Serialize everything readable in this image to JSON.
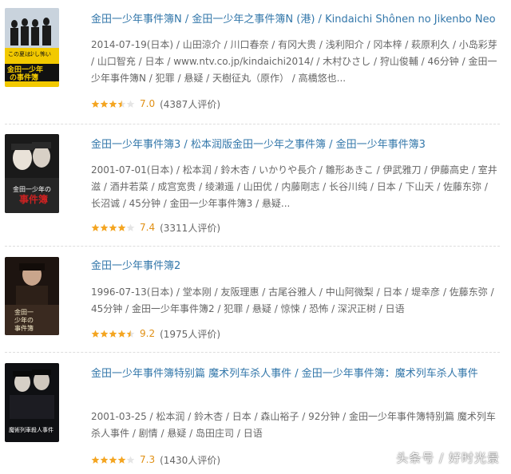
{
  "colors": {
    "link": "#3377aa",
    "meta_text": "#666666",
    "score": "#e09015",
    "star_full": "#f4a521",
    "star_empty": "#e5e5e5",
    "divider": "#dddddd"
  },
  "items": [
    {
      "title_parts": [
        "金田一少年事件簿N",
        "金田一少年之事件簿N (港)",
        "Kindaichi Shônen no Jikenbo Neo"
      ],
      "meta": "2014-07-19(日本) / 山田涼介 / 川口春奈 / 有冈大贵 / 浅利阳介 / 冈本梓 / 萩原利久 / 小岛彩芽 / 山口智充 / 日本 / www.ntv.co.jp/kindaichi2014/ / 木村ひさし / 狩山俊輔 / 46分钟 / 金田一少年事件簿N / 犯罪 / 悬疑 / 天樹征丸（原作） / 高橋悠也...",
      "stars": 3.5,
      "score": "7.0",
      "count": "(4387人评价)",
      "poster_text": [
        "この夏は、",
        "少し怖い",
        "金田一少年",
        "の事件簿"
      ]
    },
    {
      "title_parts": [
        "金田一少年事件簿3",
        "松本润版金田一少年之事件簿",
        "金田一少年事件簿3"
      ],
      "meta": "2001-07-01(日本) / 松本润 / 鈴木杏 / いかりや長介 / 雛形あきこ / 伊武雅刀 / 伊藤高史 / 室井滋 / 酒井若菜 / 成宫宽贵 / 绫濑遥 / 山田优 / 内藤剛志 / 长谷川纯 / 日本 / 下山天 / 佐藤东弥 / 长沼诚 / 45分钟 / 金田一少年事件簿3 / 悬疑...",
      "stars": 4,
      "score": "7.4",
      "count": "(3311人评价)",
      "poster_text": [
        "金田一少年の",
        "事件簿"
      ]
    },
    {
      "title_parts": [
        "金田一少年事件簿2"
      ],
      "meta": "1996-07-13(日本) / 堂本刚 / 友阪理惠 / 古尾谷雅人 / 中山阿微梨 / 日本 / 堤幸彦 / 佐藤东弥 / 45分钟 / 金田一少年事件簿2 / 犯罪 / 悬疑 / 惊悚 / 恐怖 / 深沢正树 / 日语",
      "stars": 4.5,
      "score": "9.2",
      "count": "(1975人评价)",
      "poster_text": [
        "金田一",
        "少年の",
        "事件簿"
      ]
    },
    {
      "title_parts": [
        "金田一少年事件簿特别篇 魔术列车杀人事件",
        "金田一少年事件簿：魔术列车杀人事件"
      ],
      "meta": "2001-03-25 / 松本润 / 鈴木杏 / 日本 / 森山裕子 / 92分钟 / 金田一少年事件簿特别篇 魔术列车杀人事件 / 剧情 / 悬疑 / 岛田庄司 / 日语",
      "stars": 4,
      "score": "7.3",
      "count": "(1430人评价)",
      "poster_text": [
        "魔術列車殺人事件"
      ]
    }
  ],
  "watermark": "头条号 / 好时光景"
}
